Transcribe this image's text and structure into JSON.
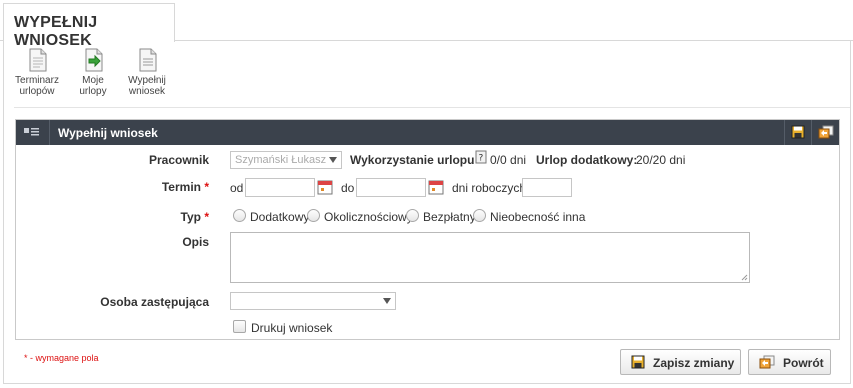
{
  "tab": {
    "title": "WYPEŁNIJ WNIOSEK"
  },
  "toolbar": {
    "items": [
      {
        "label_line1": "Terminarz",
        "label_line2": "urlopów",
        "icon": "calendar-doc-icon"
      },
      {
        "label_line1": "Moje",
        "label_line2": "urlopy",
        "icon": "doc-arrow-icon"
      },
      {
        "label_line1": "Wypełnij",
        "label_line2": "wniosek",
        "icon": "doc-fill-icon"
      }
    ]
  },
  "panel": {
    "title": "Wypełnij wniosek",
    "icons": {
      "save": "save-icon",
      "restore": "restore-icon"
    }
  },
  "form": {
    "pracownik": {
      "label": "Pracownik",
      "value": "Szymański Łukasz",
      "usage_label": "Wykorzystanie urlopu",
      "usage_value": "0/0 dni",
      "extra_label": "Urlop dodatkowy:",
      "extra_value": "20/20 dni"
    },
    "termin": {
      "label": "Termin",
      "required": "*",
      "od": "od",
      "do": "do",
      "dni": "dni roboczych",
      "od_value": "",
      "do_value": "",
      "dni_value": ""
    },
    "typ": {
      "label": "Typ",
      "required": "*",
      "options": [
        "Dodatkowy",
        "Okolicznościowy",
        "Bezpłatny",
        "Nieobecność inna"
      ]
    },
    "opis": {
      "label": "Opis",
      "value": ""
    },
    "osoba": {
      "label": "Osoba zastępująca",
      "value": ""
    },
    "drukuj": {
      "label": "Drukuj wniosek",
      "checked": false
    }
  },
  "footer": {
    "required_note": "* - wymagane pola",
    "save_label": "Zapisz zmiany",
    "back_label": "Powrót"
  }
}
